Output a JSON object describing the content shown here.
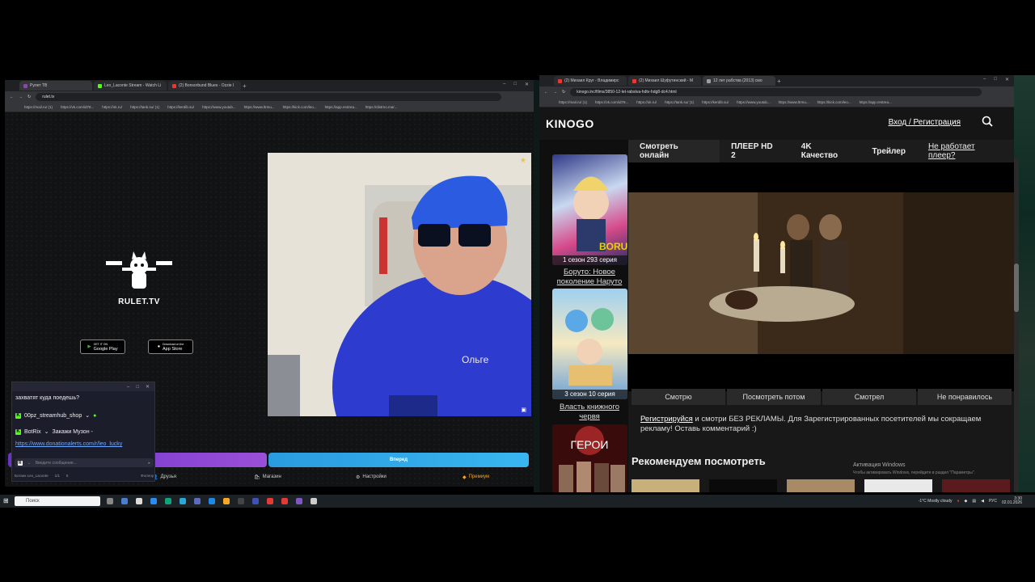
{
  "left_browser": {
    "tabs": [
      {
        "label": "Рулет ТВ",
        "color": "#8e44ad"
      },
      {
        "label": "Leo_Laconte Stream - Watch Li",
        "color": "#53fc18"
      },
      {
        "label": "(2) Bonsorbund Blues - Ozzie I",
        "color": "#e53935"
      }
    ],
    "url": "rulet.tv",
    "bookmarks": [
      "https://mail.ru/ (1)",
      "https://vk.com/id78...",
      "https://ok.ru/",
      "https://tank.su/ (1)",
      "https://kerdib.su/",
      "https://www.youtub...",
      "https://www.ltrmu...",
      "https://kick.com/leo...",
      "https://app.restrea...",
      "https://distrno.ma/..."
    ]
  },
  "rulet": {
    "logo_text": "RULET.TV",
    "google_play": {
      "small": "GET IT ON",
      "label": "Google Play"
    },
    "app_store": {
      "small": "Download on the",
      "label": "App Store"
    },
    "blue_button_label": "Вперед",
    "nav": {
      "friends": "Друзья",
      "shop": "Магазин",
      "settings": "Настройки",
      "premium": "Премиум"
    }
  },
  "chat_popup": {
    "messages": [
      {
        "user": "",
        "text": "захватят куда поедешь?"
      },
      {
        "user": "00pz_streamhub_shop",
        "text": ""
      },
      {
        "user": "BotRix",
        "text": "Закажи Музон -"
      },
      {
        "user": "",
        "text": "https://www.donationalerts.com/r/leo_lucky"
      }
    ],
    "input_placeholder": "Введите сообщение...",
    "footer": {
      "name": "Ботанк Leo_Laconte",
      "count": "1/1",
      "viewers": "5",
      "follows": "Фоллоу"
    }
  },
  "right_browser": {
    "tabs": [
      {
        "label": "(2) Михаил Круг - Владимирс",
        "color": "#e53935"
      },
      {
        "label": "(2) Михаил Шуфутинский - М",
        "color": "#e53935"
      },
      {
        "label": "12 лет рабства (2013) смо",
        "color": "#9e9e9e"
      }
    ],
    "url": "kinogo.inc/films/3850-12-let-rabstva-hdtv-hdg8-dc4.html",
    "bookmarks": [
      "https://mail.ru/ (1)",
      "https://vk.com/id78...",
      "https://ok.ru/",
      "https://tank.su/ (1)",
      "https://kerdib.su/",
      "https://www.youtub...",
      "https://www.ltrmu...",
      "https://kick.com/leo...",
      "https://app.restrea..."
    ]
  },
  "kinogo": {
    "logo": "KINOGO",
    "login": "Вход",
    "separator": "/",
    "register": "Регистрация",
    "tabs": [
      "Смотреть онлайн",
      "ПЛЕЕР HD 2",
      "4K Качество",
      "Трейлер",
      "Не работает плеер?"
    ],
    "posters": [
      {
        "badge": "1 сезон 293 серия",
        "title": "Боруто: Новое поколение Наруто"
      },
      {
        "badge": "3 сезон 10 серия",
        "title": "Власть книжного червя"
      },
      {
        "badge": "",
        "title": "ГЕРОИ"
      }
    ],
    "mark_buttons": [
      "Смотрю",
      "Посмотреть потом",
      "Смотрел",
      "Не понравилось"
    ],
    "register_link": "Регистрируйся",
    "register_note": " и смотри БЕЗ РЕКЛАМЫ. Для Зарегистрированных посетителей мы сокращаем рекламу! Оставь комментарий :)",
    "recommend_title": "Рекомендуем посмотреть",
    "windows_activation": "Активация Windows",
    "windows_activation_sub": "Чтобы активировать Windows, перейдите в раздел \"Параметры\"."
  },
  "taskbar": {
    "search_placeholder": "Поиск",
    "weather": "-1°C  Mostly cloudy",
    "lang": "РУС",
    "time": "3:30",
    "date": "02.01.2026"
  }
}
